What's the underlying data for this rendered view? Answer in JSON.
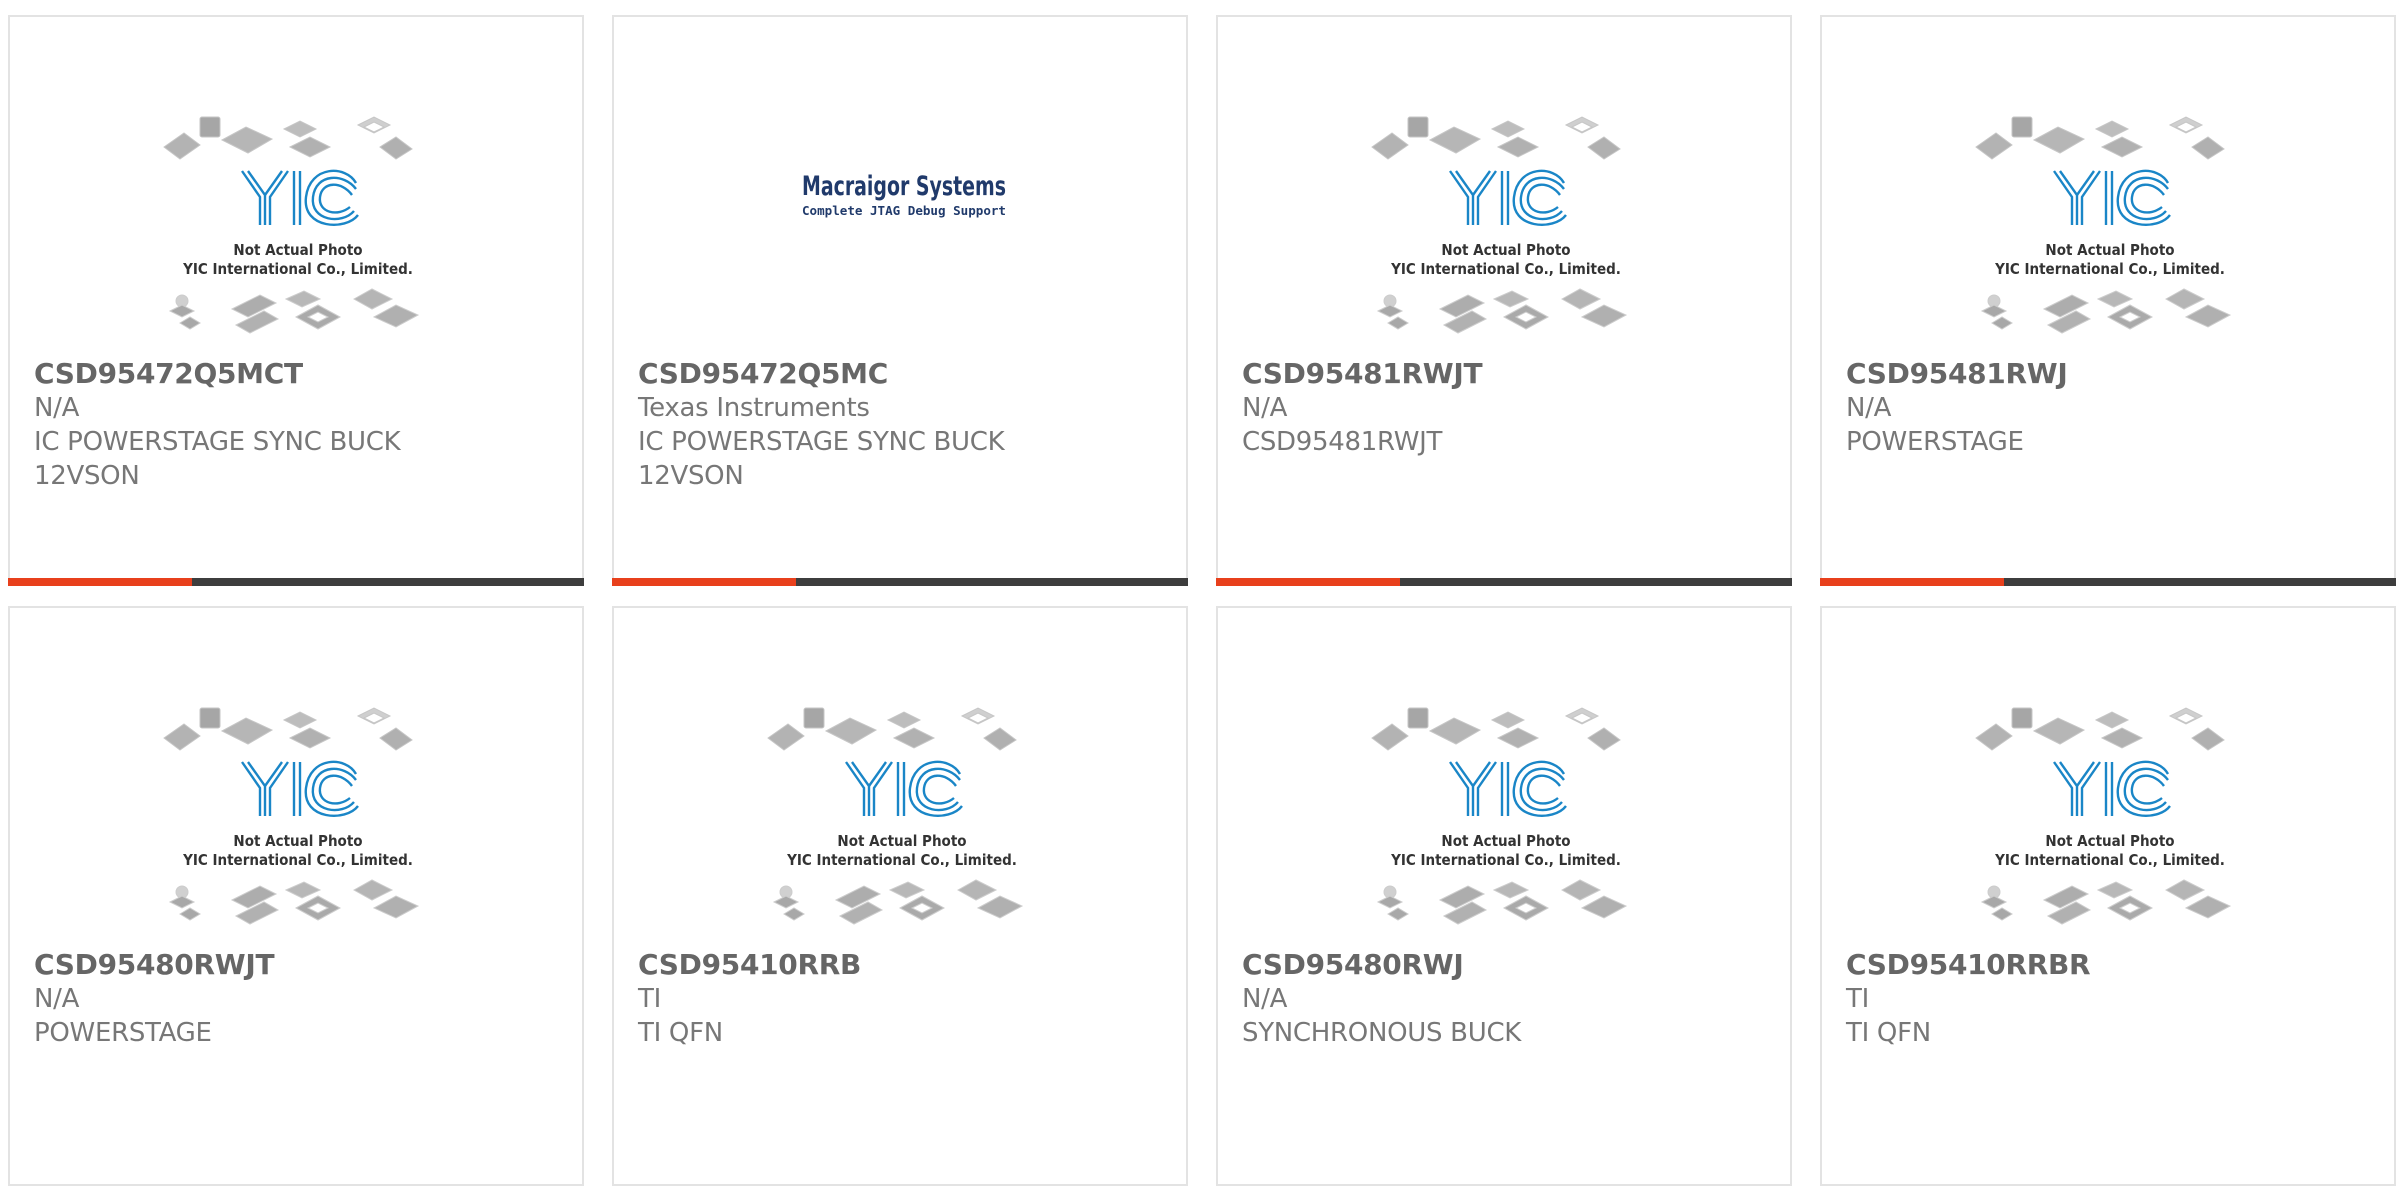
{
  "colors": {
    "accent_bar": "#e8401c",
    "dark_bar": "#3d3d3d",
    "card_border": "#e3e3e3",
    "part_number": "#666666",
    "text": "#777777",
    "yic_logo": "#1a86c7",
    "macraigor_logo": "#203a6b"
  },
  "placeholder_image": {
    "caption_line1": "Not Actual Photo",
    "caption_line2": "YIC International Co., Limited.",
    "logo_text": "YIC"
  },
  "macraigor_logo": {
    "name": "Macraigor Systems",
    "tagline": "Complete JTAG Debug Support"
  },
  "products": [
    {
      "part_number": "CSD95472Q5MCT",
      "manufacturer": "N/A",
      "description": [
        "IC POWERSTAGE SYNC BUCK",
        "12VSON"
      ],
      "image": "yic-placeholder"
    },
    {
      "part_number": "CSD95472Q5MC",
      "manufacturer": "Texas Instruments",
      "description": [
        "IC POWERSTAGE SYNC BUCK",
        "12VSON"
      ],
      "image": "macraigor-logo"
    },
    {
      "part_number": "CSD95481RWJT",
      "manufacturer": "N/A",
      "description": [
        "CSD95481RWJT"
      ],
      "image": "yic-placeholder"
    },
    {
      "part_number": "CSD95481RWJ",
      "manufacturer": "N/A",
      "description": [
        "POWERSTAGE"
      ],
      "image": "yic-placeholder"
    },
    {
      "part_number": "CSD95480RWJT",
      "manufacturer": "N/A",
      "description": [
        "POWERSTAGE"
      ],
      "image": "yic-placeholder"
    },
    {
      "part_number": "CSD95410RRB",
      "manufacturer": "TI",
      "description": [
        "TI QFN"
      ],
      "image": "yic-placeholder"
    },
    {
      "part_number": "CSD95480RWJ",
      "manufacturer": "N/A",
      "description": [
        "SYNCHRONOUS BUCK"
      ],
      "image": "yic-placeholder"
    },
    {
      "part_number": "CSD95410RRBR",
      "manufacturer": "TI",
      "description": [
        "TI QFN"
      ],
      "image": "yic-placeholder"
    }
  ]
}
